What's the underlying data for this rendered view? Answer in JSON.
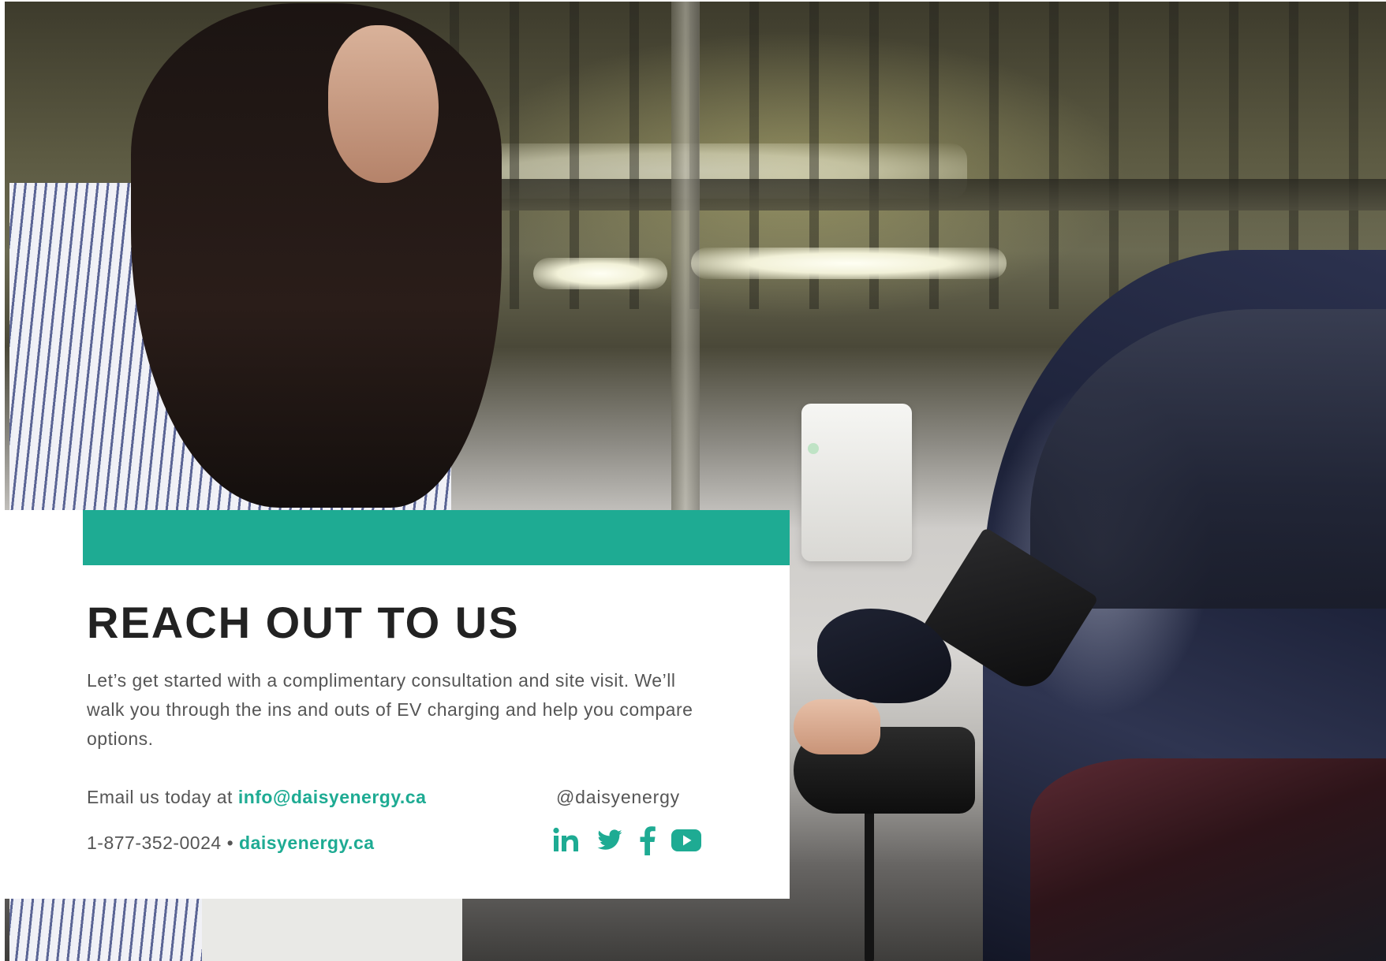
{
  "contact": {
    "heading": "REACH OUT TO US",
    "intro": "Let’s get started with a complimentary consultation and site visit. We’ll walk you through the ins and outs of EV charging and help you compare options.",
    "email_prefix": "Email us today at",
    "email": "info@daisyenergy.ca",
    "phone": "1-877-352-0024",
    "separator": "•",
    "website": "daisyenergy.ca",
    "social_handle": "@daisyenergy",
    "social_icons": [
      "linkedin-icon",
      "twitter-icon",
      "facebook-icon",
      "youtube-icon"
    ]
  },
  "colors": {
    "accent": "#1eab93",
    "heading": "#222222",
    "body_text": "#555555",
    "card_background": "#ffffff"
  }
}
